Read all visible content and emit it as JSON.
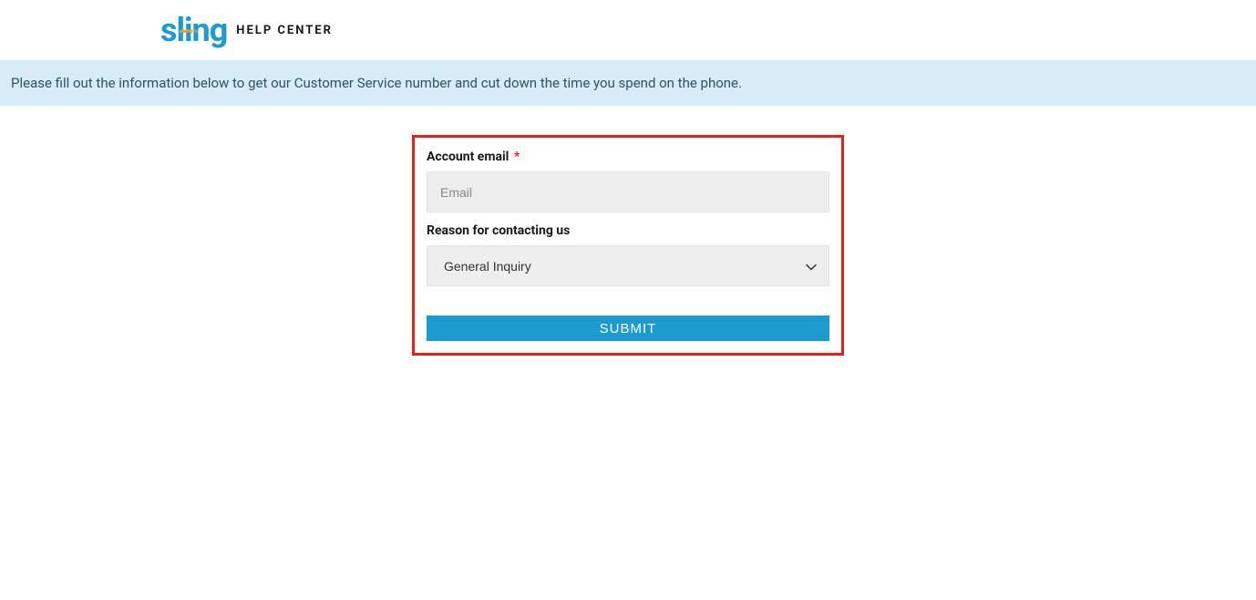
{
  "header": {
    "logo_brand": "sling",
    "logo_suffix": "HELP CENTER"
  },
  "banner": {
    "text": "Please fill out the information below to get our Customer Service number and cut down the time you spend on the phone."
  },
  "form": {
    "email_label": "Account email",
    "email_required": "*",
    "email_placeholder": "Email",
    "email_value": "",
    "reason_label": "Reason for contacting us",
    "reason_selected": "General Inquiry",
    "submit_label": "SUBMIT"
  }
}
